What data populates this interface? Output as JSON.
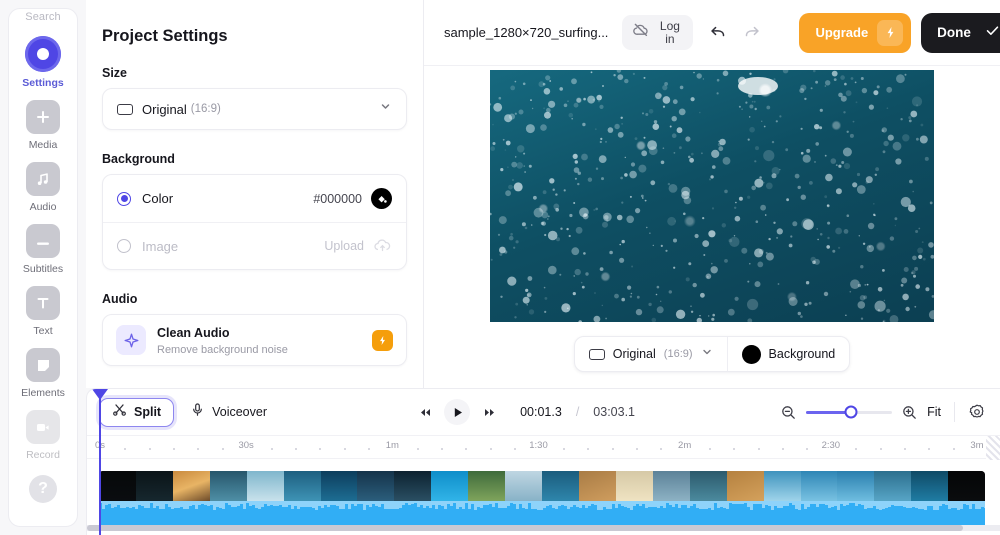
{
  "sidebar": {
    "top_label": "Search",
    "items": [
      {
        "label": "Settings",
        "icon": "settings-circle-icon",
        "active": true
      },
      {
        "label": "Media",
        "icon": "plus-icon",
        "active": false
      },
      {
        "label": "Audio",
        "icon": "music-note-icon",
        "active": false
      },
      {
        "label": "Subtitles",
        "icon": "subtitles-icon",
        "active": false
      },
      {
        "label": "Text",
        "icon": "text-t-icon",
        "active": false
      },
      {
        "label": "Elements",
        "icon": "shapes-icon",
        "active": false
      },
      {
        "label": "Record",
        "icon": "camera-icon",
        "active": false
      }
    ],
    "help_label": "?"
  },
  "panel": {
    "title": "Project Settings",
    "size": {
      "label": "Size",
      "value": "Original",
      "ratio": "(16:9)"
    },
    "background": {
      "label": "Background",
      "color_option": "Color",
      "color_value": "#000000",
      "swatch_hex": "#000000",
      "image_option": "Image",
      "upload_label": "Upload"
    },
    "audio": {
      "label": "Audio",
      "clean_audio_title": "Clean Audio",
      "clean_audio_sub": "Remove background noise",
      "badge": "pro-bolt-badge"
    }
  },
  "header": {
    "filename": "sample_1280×720_surfing...",
    "login_label_line1": "Log",
    "login_label_line2": "in",
    "login_icon": "cloud-off-icon",
    "undo_icon": "undo-arrow-icon",
    "redo_icon": "redo-arrow-icon",
    "upgrade_label": "Upgrade",
    "done_label": "Done"
  },
  "preview": {
    "size_value": "Original",
    "size_ratio": "(16:9)",
    "background_label": "Background",
    "background_swatch": "#000000"
  },
  "timeline": {
    "split_label": "Split",
    "voiceover_label": "Voiceover",
    "current_time": "00:01.3",
    "separator": "/",
    "total_time": "03:03.1",
    "fit_label": "Fit",
    "ruler_ticks": [
      "0s",
      "30s",
      "1m",
      "1:30",
      "2m",
      "2:30",
      "3m"
    ],
    "zoom_percent": 52
  },
  "colors": {
    "accent": "#4f46e5",
    "upgrade": "#f9a327",
    "done": "#1b1b1f",
    "waveform": "#31aef5"
  }
}
